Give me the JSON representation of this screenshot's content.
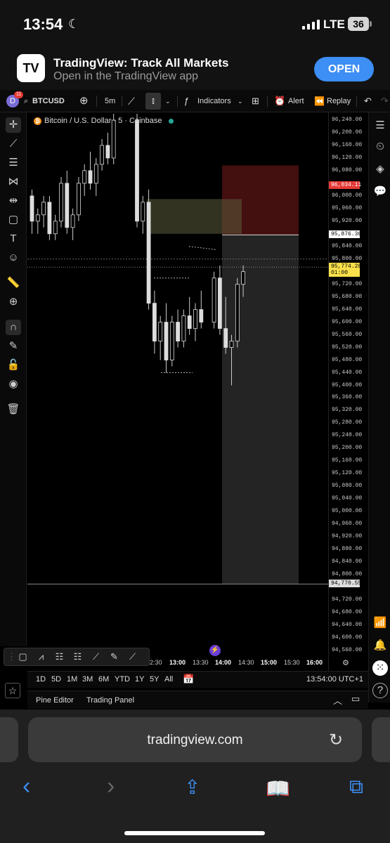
{
  "status": {
    "time": "13:54",
    "network": "LTE",
    "battery": "36"
  },
  "banner": {
    "app_name": "TradingView: Track All Markets",
    "subtitle": "Open in the TradingView app",
    "open_label": "OPEN"
  },
  "toolbar": {
    "notif_count": "11",
    "avatar_letter": "D",
    "symbol": "BTCUSD",
    "interval": "5m",
    "indicators_label": "Indicators",
    "alert_label": "Alert",
    "replay_label": "Replay"
  },
  "legend": {
    "symbol_title": "Bitcoin / U.S. Dollar · 5 · Coinbase"
  },
  "price_axis": {
    "labels": [
      "96,240.00",
      "96,200.00",
      "96,160.00",
      "96,120.00",
      "96,080.00",
      "96,000.00",
      "95,960.00",
      "95,920.00",
      "95,840.00",
      "95,800.00",
      "95,720.00",
      "95,680.00",
      "95,640.00",
      "95,600.00",
      "95,560.00",
      "95,520.00",
      "95,480.00",
      "95,440.00",
      "95,400.00",
      "95,360.00",
      "95,320.00",
      "95,280.00",
      "95,240.00",
      "95,200.00",
      "95,160.00",
      "95,120.00",
      "95,080.00",
      "95,040.00",
      "95,000.00",
      "94,960.00",
      "94,920.00",
      "94,880.00",
      "94,840.00",
      "94,800.00",
      "94,720.00",
      "94,680.00",
      "94,640.00",
      "94,600.00",
      "94,560.00"
    ],
    "stop_price": "96,034.11",
    "entry_price": "95,876.36",
    "current_price": "95,774.28",
    "countdown": "01:00",
    "target_price": "94,770.55"
  },
  "time_axis": {
    "labels": [
      "2:30",
      "13:00",
      "13:30",
      "14:00",
      "14:30",
      "15:00",
      "15:30",
      "16:00"
    ]
  },
  "range_bar": {
    "ranges": [
      "1D",
      "5D",
      "1M",
      "3M",
      "6M",
      "YTD",
      "1Y",
      "5Y",
      "All"
    ],
    "clock": "13:54:00 UTC+1"
  },
  "bottom_tabs": {
    "pine": "Pine Editor",
    "panel": "Trading Panel"
  },
  "safari": {
    "url": "tradingview.com"
  },
  "chart_data": {
    "type": "candlestick",
    "ylim": [
      94540,
      96260
    ],
    "candles": [
      [
        96000,
        96020,
        95880,
        95920
      ],
      [
        95920,
        95960,
        95880,
        95940
      ],
      [
        95940,
        96000,
        95900,
        95980
      ],
      [
        95980,
        96000,
        95860,
        95880
      ],
      [
        95880,
        95940,
        95860,
        95920
      ],
      [
        95920,
        96060,
        95900,
        96040
      ],
      [
        96040,
        96080,
        95880,
        95900
      ],
      [
        95900,
        95960,
        95860,
        95940
      ],
      [
        95940,
        96060,
        95920,
        96040
      ],
      [
        96040,
        96100,
        96000,
        96080
      ],
      [
        96080,
        96140,
        96020,
        96040
      ],
      [
        96040,
        96120,
        96000,
        96100
      ],
      [
        96100,
        96180,
        96080,
        96160
      ],
      [
        96160,
        96200,
        96100,
        96120
      ],
      [
        96120,
        96260,
        96100,
        96240
      ],
      [
        96240,
        96260,
        95900,
        95920
      ],
      [
        95920,
        96000,
        95880,
        95980
      ],
      [
        95980,
        96020,
        95640,
        95660
      ],
      [
        95660,
        95700,
        95500,
        95540
      ],
      [
        95540,
        95620,
        95480,
        95600
      ],
      [
        95600,
        95660,
        95440,
        95480
      ],
      [
        95480,
        95620,
        95460,
        95600
      ],
      [
        95600,
        95640,
        95520,
        95540
      ],
      [
        95540,
        95640,
        95520,
        95620
      ],
      [
        95620,
        95680,
        95560,
        95580
      ],
      [
        95580,
        95660,
        95540,
        95640
      ],
      [
        95640,
        95700,
        95580,
        95600
      ],
      [
        95600,
        95760,
        95580,
        95740
      ],
      [
        95740,
        95780,
        95560,
        95580
      ],
      [
        95580,
        95680,
        95500,
        95520
      ],
      [
        95520,
        95560,
        95400,
        95540
      ],
      [
        95540,
        95740,
        95520,
        95720
      ],
      [
        95720,
        95780,
        95680,
        95760
      ]
    ],
    "position": {
      "entry": 95876.36,
      "stop": 96034.11,
      "target": 94770.55
    }
  }
}
